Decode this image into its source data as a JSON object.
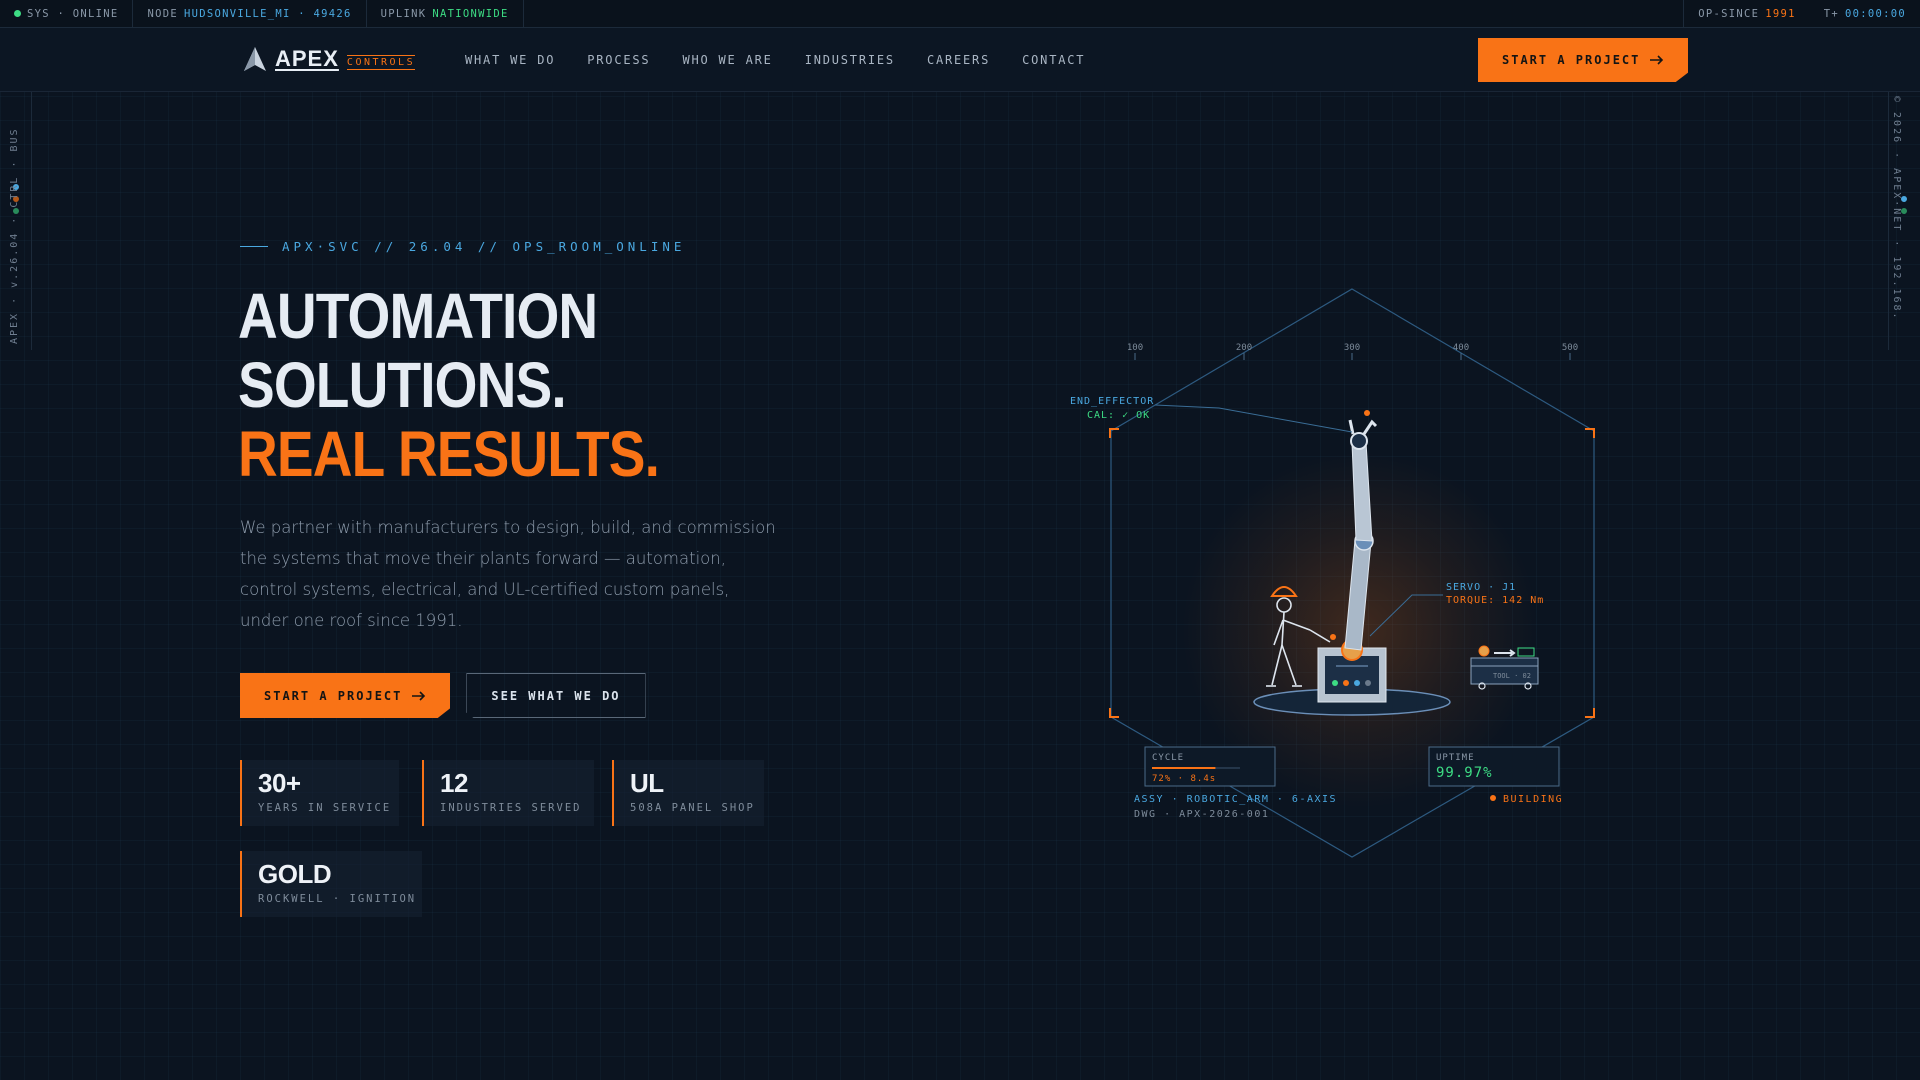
{
  "statusbar": {
    "sys_label": "SYS · ONLINE",
    "node_label": "NODE",
    "node_value": "HUDSONVILLE_MI · 49426",
    "uplink_label": "UPLINK",
    "uplink_value": "NATIONWIDE",
    "opsince_label": "OP-SINCE",
    "opsince_value": "1991",
    "timer_label": "T+",
    "timer_value": "00:00:00"
  },
  "nav": {
    "logo_text": "APEX",
    "logo_sub": "CONTROLS",
    "links": [
      "WHAT WE DO",
      "PROCESS",
      "WHO WE ARE",
      "INDUSTRIES",
      "CAREERS",
      "CONTACT"
    ],
    "cta": "START A PROJECT"
  },
  "rails": {
    "left": "APEX · v.26.04 · CTRL · BUS",
    "right": "© 2026 · APEX·NET · 192.168.",
    "colors": {
      "accent": "#f97316",
      "blue": "#4aa8e0",
      "green": "#3ddc84"
    }
  },
  "hero": {
    "kicker": "APX·SVC // 26.04 // OPS_ROOM_ONLINE",
    "headline_1": "AUTOMATION",
    "headline_2": "SOLUTIONS.",
    "headline_3": "REAL RESULTS.",
    "lede": "We partner with manufacturers to design, build, and commission the systems that move their plants forward — automation, control systems, electrical, and UL-certified custom panels, under one roof since 1991.",
    "cta_primary": "START A PROJECT",
    "cta_secondary": "SEE WHAT WE DO"
  },
  "stats": [
    {
      "value": "30+",
      "label": "YEARS IN SERVICE"
    },
    {
      "value": "12",
      "label": "INDUSTRIES SERVED"
    },
    {
      "value": "UL",
      "label": "508A PANEL SHOP"
    },
    {
      "value": "GOLD",
      "label": "ROCKWELL · IGNITION"
    }
  ],
  "illustration": {
    "ruler_ticks": [
      "100",
      "200",
      "300",
      "400",
      "500"
    ],
    "end_effector": "END_EFFECTOR",
    "cal": "CAL: ✓ OK",
    "servo": "SERVO · J1",
    "torque": "TORQUE: 142 Nm",
    "cycle_title": "CYCLE",
    "cycle_value": "72% · 8.4s",
    "cycle_progress": 0.72,
    "uptime_title": "UPTIME",
    "uptime_value": "99.97%",
    "assy": "ASSY · ROBOTIC_ARM · 6-AXIS",
    "dwg": "DWG · APX-2026-001",
    "status": "BUILDING",
    "cart_label": "TOOL · 02"
  }
}
